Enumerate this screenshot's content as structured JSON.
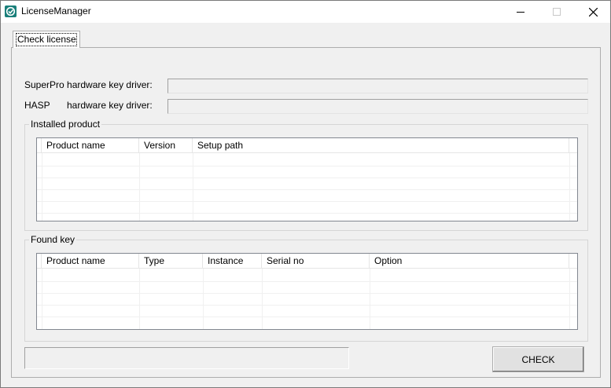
{
  "window": {
    "title": "LicenseManager",
    "icon": "license-check-icon"
  },
  "tabs": [
    {
      "label": "Check license",
      "selected": true
    }
  ],
  "drivers": {
    "superpro_label": "SuperPro hardware key driver:",
    "superpro_value": "",
    "hasp_label_prefix": "HASP",
    "hasp_label_suffix": "hardware key driver:",
    "hasp_value": ""
  },
  "installed_product": {
    "legend": "Installed product",
    "columns": [
      "Product name",
      "Version",
      "Setup path"
    ],
    "rows": []
  },
  "found_key": {
    "legend": "Found key",
    "columns": [
      "Product name",
      "Type",
      "Instance",
      "Serial no",
      "Option"
    ],
    "rows": []
  },
  "status_text": "",
  "check_button": "CHECK",
  "colors": {
    "titlebar": "#ffffff",
    "window_bg": "#f0f0f0",
    "icon_accent": "#1a7f7a"
  }
}
